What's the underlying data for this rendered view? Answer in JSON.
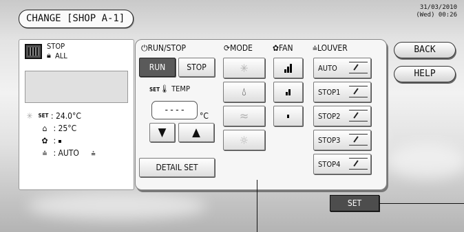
{
  "header": {
    "title": "CHANGE [SHOP A-1]",
    "date": "31/03/2010",
    "time": "(Wed) 00:26"
  },
  "status_panel": {
    "state": "STOP",
    "lock_label": "ALL",
    "set_temp_label": "SET",
    "set_temp": ": 24.0°C",
    "room_temp": ": 25°C",
    "fan_value": ":",
    "louver_value": ": AUTO",
    "icons": [
      "unit-icon",
      "lock-icon",
      "snowflake-icon",
      "thermometer-icon",
      "house-icon",
      "fan-icon",
      "louver-icon"
    ]
  },
  "run_stop": {
    "header": "RUN/STOP",
    "run_label": "RUN",
    "stop_label": "STOP",
    "selected": "RUN"
  },
  "temp": {
    "header": "TEMP",
    "set_prefix": "SET",
    "display": "----",
    "unit": "°C",
    "down_label": "▼",
    "up_label": "▲"
  },
  "mode": {
    "header": "MODE",
    "buttons": [
      {
        "name": "cool",
        "icon": "✳",
        "enabled": false
      },
      {
        "name": "dry",
        "icon": "Δ",
        "enabled": true
      },
      {
        "name": "fan",
        "icon": "≈",
        "enabled": false
      },
      {
        "name": "heat",
        "icon": "☼",
        "enabled": false
      }
    ]
  },
  "fan": {
    "header": "FAN",
    "levels": [
      "high",
      "mid",
      "low"
    ]
  },
  "louver": {
    "header": "LOUVER",
    "buttons": [
      "AUTO",
      "STOP1",
      "STOP2",
      "STOP3",
      "STOP4"
    ]
  },
  "detail_set_label": "DETAIL SET",
  "side": {
    "back_label": "BACK",
    "help_label": "HELP"
  },
  "set_label": "SET",
  "colors": {
    "selected_button": "#5a5a5a",
    "set_button": "#4d4d4d",
    "panel": "#f6f6f6"
  }
}
